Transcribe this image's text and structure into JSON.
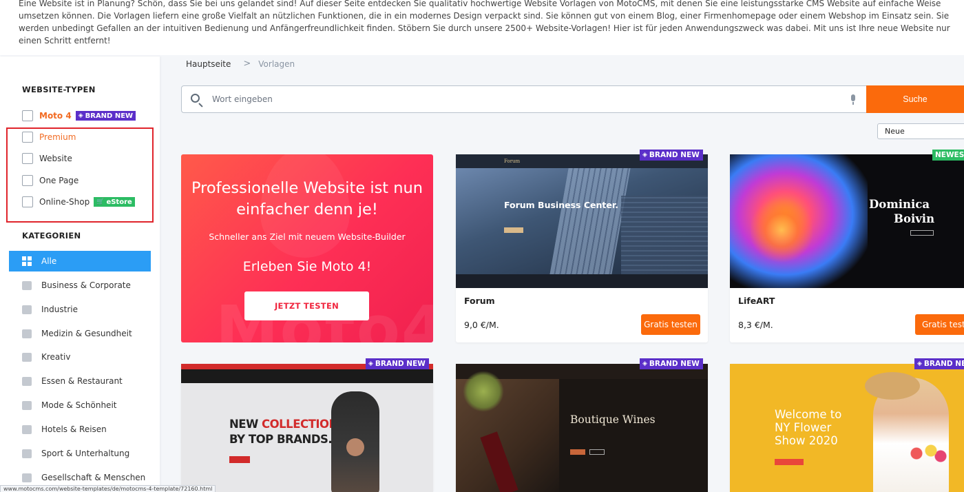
{
  "intro": {
    "text": "Eine Website ist in Planung? Schön, dass Sie bei uns gelandet sind! Auf dieser Seite entdecken Sie qualitativ hochwertige Website Vorlagen von MotoCMS, mit denen Sie eine leistungsstarke CMS Website auf einfache Weise umsetzen können. Die Vorlagen liefern eine große Vielfalt an nützlichen Funktionen, die in ein modernes Design verpackt sind. Sie können gut von einem Blog, einer Firmenhomepage oder einem Webshop im Einsatz sein. Sie werden unbedingt Gefallen an der intuitiven Bedienung und Anfängerfreundlichkeit finden. Stöbern Sie durch unsere 2500+ Website-Vorlagen! Hier ist für jeden Anwendungszweck was dabei. Mit uns ist Ihre neue Website nur einen Schritt entfernt!"
  },
  "sidebar": {
    "types_title": "WEBSITE-TYPEN",
    "types": [
      {
        "label": "Moto 4",
        "badge": "BRAND NEW"
      },
      {
        "label": "Premium"
      },
      {
        "label": "Website"
      },
      {
        "label": "One Page"
      },
      {
        "label": "Online-Shop",
        "badge": "eStore"
      }
    ],
    "categories_title": "KATEGORIEN",
    "categories": [
      {
        "label": "Alle",
        "icon": "grid-icon"
      },
      {
        "label": "Business & Corporate",
        "icon": "briefcase-icon"
      },
      {
        "label": "Industrie",
        "icon": "factory-icon"
      },
      {
        "label": "Medizin & Gesundheit",
        "icon": "medical-icon"
      },
      {
        "label": "Kreativ",
        "icon": "camera-icon"
      },
      {
        "label": "Essen & Restaurant",
        "icon": "restaurant-icon"
      },
      {
        "label": "Mode & Schönheit",
        "icon": "fashion-icon"
      },
      {
        "label": "Hotels & Reisen",
        "icon": "travel-icon"
      },
      {
        "label": "Sport & Unterhaltung",
        "icon": "sport-icon"
      },
      {
        "label": "Gesellschaft & Menschen",
        "icon": "people-icon"
      }
    ]
  },
  "breadcrumb": {
    "home": "Hauptseite",
    "separator": ">",
    "current": "Vorlagen"
  },
  "search": {
    "placeholder": "Wort eingeben",
    "button": "Suche"
  },
  "sort": {
    "selected": "Neue"
  },
  "promo": {
    "title": "Professionelle Website ist nun einfacher denn je!",
    "subtitle": "Schneller ans Ziel mit neuem Website-Builder",
    "cta_text": "Erleben Sie Moto 4!",
    "button": "JETZT TESTEN",
    "watermark": "Moto4"
  },
  "cards": [
    {
      "name": "Forum",
      "price": "9,0 €/M.",
      "button": "Gratis testen",
      "ribbon": "BRAND NEW",
      "thumb_title": "Forum Business Center."
    },
    {
      "name": "LifeART",
      "price": "8,3 €/M.",
      "button": "Gratis teste",
      "ribbon": "NEWES",
      "thumb_title_1": "Dominica",
      "thumb_title_2": "Boivin"
    },
    {
      "ribbon": "BRAND NEW",
      "thumb_title_1": "NEW ",
      "thumb_title_accent": "COLLECTIONS",
      "thumb_title_2": "BY TOP BRANDS."
    },
    {
      "ribbon": "BRAND NEW",
      "thumb_title": "Boutique Wines"
    },
    {
      "ribbon": "BRAND NEW",
      "thumb_title_1": "Welcome to",
      "thumb_title_2": "NY Flower",
      "thumb_title_3": "Show 2020"
    }
  ],
  "status_url": "www.motocms.com/website-templates/de/motocms-4-template/72160.html",
  "colors": {
    "accent_orange": "#fb6a0c",
    "brand_purple": "#5b2fc9",
    "estore_green": "#2cbc63",
    "active_blue": "#2b9df5",
    "highlight_red": "#e0242b"
  }
}
